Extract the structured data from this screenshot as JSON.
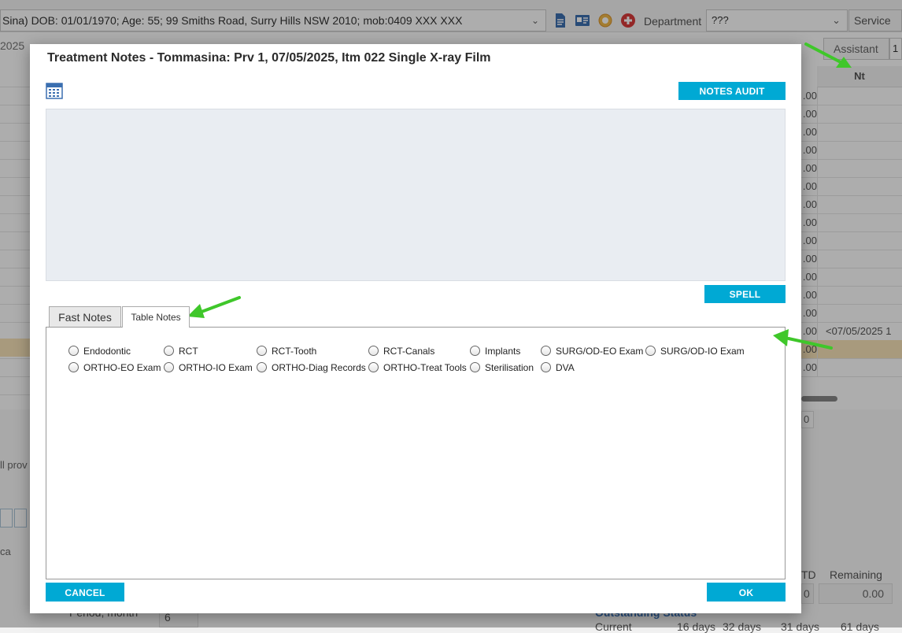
{
  "background": {
    "patient_info": "Sina) DOB: 01/01/1970; Age: 55; 99 Smiths Road, Surry Hills NSW 2010; mob:0409 XXX XXX",
    "department_label": "Department",
    "department_value": "???",
    "service_label": "Service",
    "date_partial": "2025",
    "assistant_label": "Assistant",
    "assistant_value": "1",
    "grid_header": "Nt",
    "grid_rows": [
      {
        "c1": ".00",
        "c2": ""
      },
      {
        "c1": ".00",
        "c2": ""
      },
      {
        "c1": ".00",
        "c2": ""
      },
      {
        "c1": ".00",
        "c2": ""
      },
      {
        "c1": ".00",
        "c2": ""
      },
      {
        "c1": ".00",
        "c2": ""
      },
      {
        "c1": ".00",
        "c2": ""
      },
      {
        "c1": ".00",
        "c2": ""
      },
      {
        "c1": ".00",
        "c2": ""
      },
      {
        "c1": ".00",
        "c2": ""
      },
      {
        "c1": ".00",
        "c2": ""
      },
      {
        "c1": ".00",
        "c2": ""
      },
      {
        "c1": ".00",
        "c2": ""
      },
      {
        "c1": ".00",
        "c2": "<07/05/2025 1"
      },
      {
        "c1": ".00",
        "c2": ""
      },
      {
        "c1": ".00",
        "c2": ""
      }
    ],
    "all_providers_partial": "ll prov",
    "ca_partial": "ca",
    "small_value": "0",
    "td_partial": "TD",
    "remaining_label": "Remaining",
    "zero_value": "0",
    "remaining_value": "0.00",
    "period_label": "Period, month",
    "period_value": "6",
    "outstanding_label": "Outstanding Status",
    "current_label": "Current",
    "days_16": "16 days",
    "days_32": "32 days",
    "days_31": "31 days",
    "days_61": "61 days"
  },
  "modal": {
    "title": "Treatment Notes - Tommasina: Prv 1, 07/05/2025, Itm 022 Single X-ray Film",
    "audit_button": "NOTES AUDIT TRAIL...",
    "notes_text": "",
    "spell_button": "SPELL CHECK...",
    "tabs": [
      "Fast Notes",
      "Table Notes"
    ],
    "active_tab": "Table Notes",
    "radio_options": [
      "Endodontic",
      "RCT",
      "RCT-Tooth",
      "RCT-Canals",
      "Implants",
      "SURG/OD-EO Exam",
      "SURG/OD-IO Exam",
      "ORTHO-EO Exam",
      "ORTHO-IO Exam",
      "ORTHO-Diag Records",
      "ORTHO-Treat Tools",
      "Sterilisation",
      "DVA"
    ],
    "cancel_button": "CANCEL",
    "ok_button": "OK"
  },
  "colors": {
    "accent": "#00a9d4",
    "annotation_arrow": "#3fc72a",
    "highlight_row": "#f8e3b8"
  }
}
